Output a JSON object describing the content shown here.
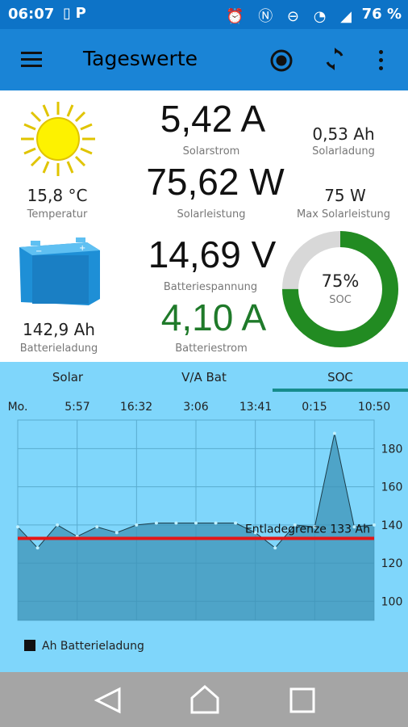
{
  "status": {
    "time": "06:07",
    "battery": "76 %"
  },
  "appbar": {
    "title": "Tageswerte"
  },
  "readings": {
    "solar_current": "5,42 A",
    "solar_current_label": "Solarstrom",
    "solar_charge": "0,53 Ah",
    "solar_charge_label": "Solarladung",
    "solar_power": "75,62 W",
    "solar_power_label": "Solarleistung",
    "max_solar_power": "75 W",
    "max_solar_power_label": "Max Solarleistung",
    "temperature": "15,8 °C",
    "temperature_label": "Temperatur",
    "battery_voltage": "14,69 V",
    "battery_voltage_label": "Batteriespannung",
    "battery_current": "4,10 A",
    "battery_current_label": "Batteriestrom",
    "battery_charge": "142,9 Ah",
    "battery_charge_label": "Batterieladung",
    "soc_value": "75%",
    "soc_label": "SOC",
    "soc_fraction": 0.75
  },
  "colors": {
    "statusbar": "#0d73c7",
    "appbar": "#1a84d6",
    "chart_bg": "#7fd6fb",
    "soc_green": "#228b22",
    "soc_track": "#d8d8d8",
    "battery_current_green": "#1f7a2a",
    "threshold_red": "#e51616"
  },
  "tabs": [
    {
      "label": "Solar"
    },
    {
      "label": "V/A Bat"
    },
    {
      "label": "SOC"
    }
  ],
  "chart_data": {
    "type": "area",
    "x": [
      "Mo.",
      "5:57",
      "16:32",
      "3:06",
      "13:41",
      "0:15",
      "10:50"
    ],
    "ylim": [
      90,
      195
    ],
    "yticks": [
      100,
      120,
      140,
      160,
      180
    ],
    "series": [
      {
        "name": "Ah Batterieladung",
        "values": [
          139,
          128,
          140,
          134,
          139,
          136,
          140,
          141,
          141,
          141,
          141,
          141,
          136,
          128,
          140,
          139,
          188,
          139,
          140
        ]
      }
    ],
    "threshold": {
      "value": 133,
      "label": "Entladegrenze 133 Ah"
    },
    "legend": "bottom-left"
  }
}
